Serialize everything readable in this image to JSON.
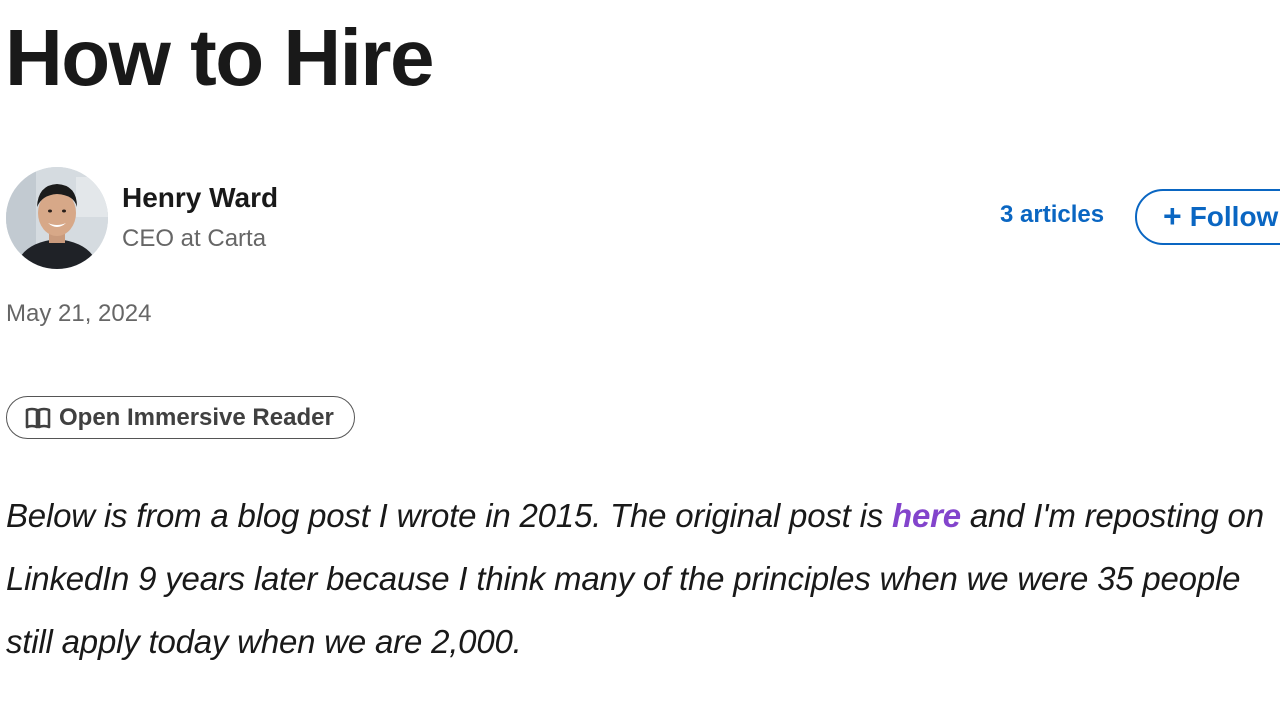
{
  "article": {
    "title": "How to Hire",
    "published_date": "May 21, 2024",
    "intro": {
      "before_link": "Below is from a blog post I wrote in 2015. The original post is ",
      "link_text": "here",
      "after_link": " and I'm reposting on LinkedIn 9 years later because I think many of the principles when we were 35 people still apply today when we are 2,000."
    }
  },
  "author": {
    "name": "Henry Ward",
    "headline": "CEO at Carta",
    "avatar_icon": "avatar-photo",
    "articles_link": "3 articles",
    "follow_label": "Follow",
    "follow_icon": "plus-icon"
  },
  "toolbar": {
    "immersive_reader_label": "Open Immersive Reader",
    "immersive_reader_icon": "book-icon"
  },
  "colors": {
    "link_blue": "#0a66c2",
    "inline_link_purple": "#8344cc",
    "text_primary": "#191919",
    "text_secondary": "#666666"
  }
}
